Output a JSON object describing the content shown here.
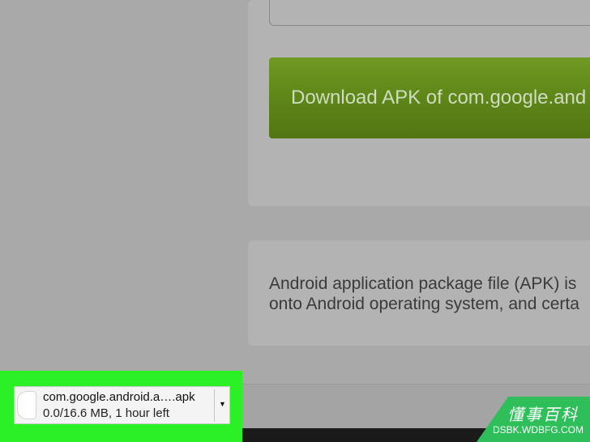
{
  "main": {
    "download_button_label": "Download APK of com.google.and",
    "info_text_line1": "Android application package file (APK) is",
    "info_text_line2": "onto Android operating system, and certa"
  },
  "download_bar": {
    "file_name": "com.google.android.a….apk",
    "status": "0.0/16.6 MB, 1 hour left",
    "highlight_color": "#2bf025"
  },
  "watermark": {
    "title": "懂事百科",
    "site": "DSBK.WDBFG.COM"
  }
}
